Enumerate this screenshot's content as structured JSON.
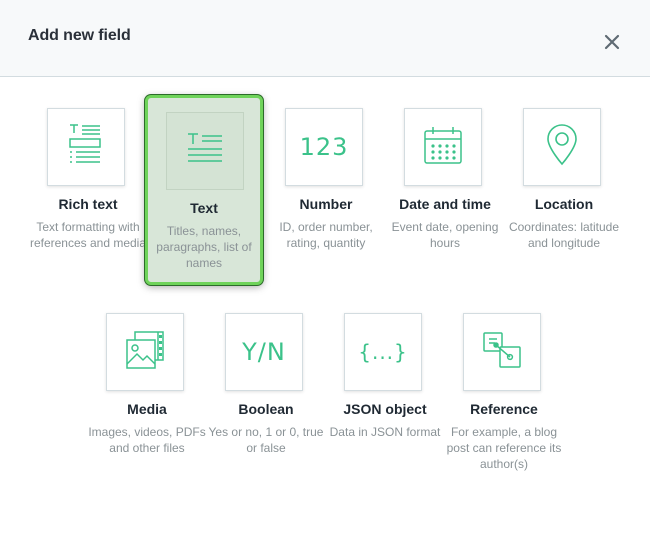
{
  "dialog": {
    "title": "Add new field",
    "close_icon": "close-icon"
  },
  "colors": {
    "accent_green": "#3bc28a",
    "selected_border": "#6fd35a",
    "header_bg": "#f7f9fa"
  },
  "field_types": [
    {
      "label": "Rich text",
      "description": "Text formatting with references and media",
      "icon": "rich-text-icon",
      "selected": false
    },
    {
      "label": "Text",
      "description": "Titles, names, paragraphs, list of names",
      "icon": "text-icon",
      "selected": true
    },
    {
      "label": "Number",
      "description": "ID, order number, rating, quantity",
      "icon": "number-icon",
      "icon_text": "123",
      "selected": false
    },
    {
      "label": "Date and time",
      "description": "Event date, opening hours",
      "icon": "calendar-icon",
      "selected": false
    },
    {
      "label": "Location",
      "description": "Coordinates: latitude and longitude",
      "icon": "location-pin-icon",
      "selected": false
    },
    {
      "label": "Media",
      "description": "Images, videos, PDFs and other files",
      "icon": "media-icon",
      "selected": false
    },
    {
      "label": "Boolean",
      "description": "Yes or no, 1 or 0, true or false",
      "icon": "boolean-icon",
      "icon_text": "Y/N",
      "selected": false
    },
    {
      "label": "JSON object",
      "description": "Data in JSON format",
      "icon": "json-icon",
      "icon_text": "{...}",
      "selected": false
    },
    {
      "label": "Reference",
      "description": "For example, a blog post can reference its author(s)",
      "icon": "reference-icon",
      "selected": false
    }
  ]
}
